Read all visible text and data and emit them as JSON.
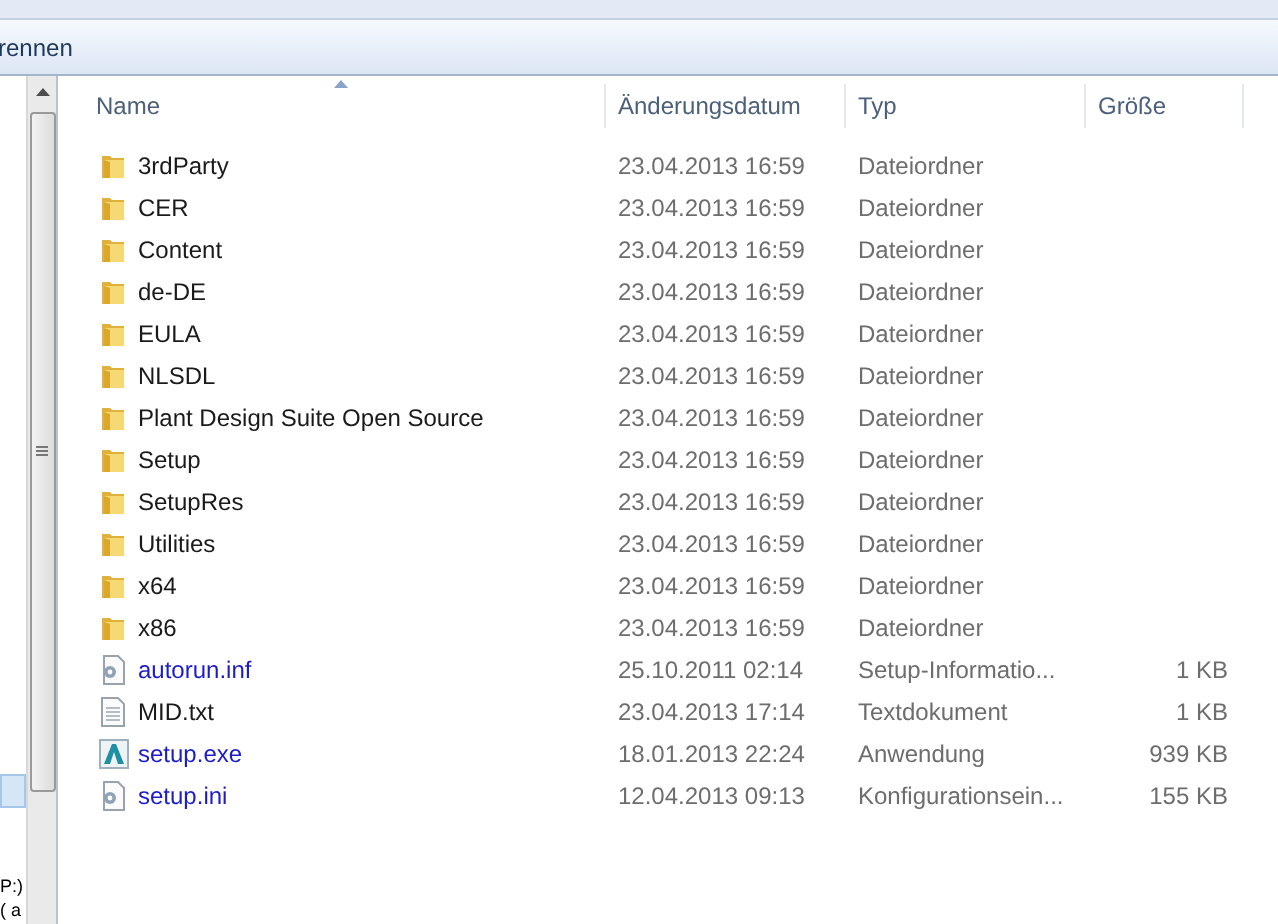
{
  "toolbar": {
    "label": "rennen"
  },
  "nav_pane": {
    "items": [
      {
        "selected": true
      },
      {
        "label": "P:)",
        "selected": false
      },
      {
        "label": "( a",
        "selected": false
      }
    ]
  },
  "columns": [
    {
      "label": "Name",
      "sorted": true
    },
    {
      "label": "Änderungsdatum",
      "sorted": false
    },
    {
      "label": "Typ",
      "sorted": false
    },
    {
      "label": "Größe",
      "sorted": false
    }
  ],
  "rows": [
    {
      "kind": "folder",
      "name": "3rdParty",
      "date": "23.04.2013 16:59",
      "type": "Dateiordner",
      "color": "#1a1a1a"
    },
    {
      "kind": "folder",
      "name": "CER",
      "date": "23.04.2013 16:59",
      "type": "Dateiordner",
      "color": "#1a1a1a"
    },
    {
      "kind": "folder",
      "name": "Content",
      "date": "23.04.2013 16:59",
      "type": "Dateiordner",
      "color": "#1a1a1a"
    },
    {
      "kind": "folder",
      "name": "de-DE",
      "date": "23.04.2013 16:59",
      "type": "Dateiordner",
      "color": "#1a1a1a"
    },
    {
      "kind": "folder",
      "name": "EULA",
      "date": "23.04.2013 16:59",
      "type": "Dateiordner",
      "color": "#1a1a1a"
    },
    {
      "kind": "folder",
      "name": "NLSDL",
      "date": "23.04.2013 16:59",
      "type": "Dateiordner",
      "color": "#1a1a1a"
    },
    {
      "kind": "folder",
      "name": "Plant Design Suite Open Source",
      "date": "23.04.2013 16:59",
      "type": "Dateiordner",
      "color": "#1a1a1a"
    },
    {
      "kind": "folder",
      "name": "Setup",
      "date": "23.04.2013 16:59",
      "type": "Dateiordner",
      "color": "#1a1a1a"
    },
    {
      "kind": "folder",
      "name": "SetupRes",
      "date": "23.04.2013 16:59",
      "type": "Dateiordner",
      "color": "#1a1a1a"
    },
    {
      "kind": "folder",
      "name": "Utilities",
      "date": "23.04.2013 16:59",
      "type": "Dateiordner",
      "color": "#1a1a1a"
    },
    {
      "kind": "folder",
      "name": "x64",
      "date": "23.04.2013 16:59",
      "type": "Dateiordner",
      "color": "#1a1a1a"
    },
    {
      "kind": "folder",
      "name": "x86",
      "date": "23.04.2013 16:59",
      "type": "Dateiordner",
      "color": "#1a1a1a"
    },
    {
      "kind": "settings",
      "name": "autorun.inf",
      "date": "25.10.2011 02:14",
      "type": "Setup-Informatio...",
      "size": "1 KB",
      "color": "#1c1cc8"
    },
    {
      "kind": "text",
      "name": "MID.txt",
      "date": "23.04.2013 17:14",
      "type": "Textdokument",
      "size": "1 KB",
      "color": "#1a1a1a"
    },
    {
      "kind": "app",
      "name": "setup.exe",
      "date": "18.01.2013 22:24",
      "type": "Anwendung",
      "size": "939 KB",
      "color": "#1c1cc8"
    },
    {
      "kind": "settings",
      "name": "setup.ini",
      "date": "12.04.2013 09:13",
      "type": "Konfigurationsein...",
      "size": "155 KB",
      "color": "#1c1cc8"
    }
  ]
}
